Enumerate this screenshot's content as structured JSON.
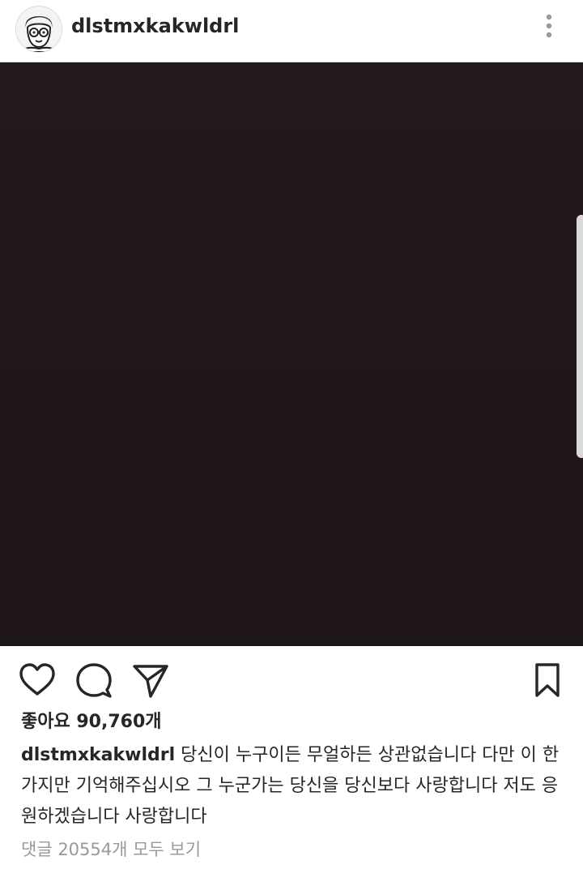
{
  "post": {
    "username": "dlstmxkakwldrl",
    "likes_text": "좋아요 90,760개",
    "caption_user": "dlstmxkakwldrl",
    "caption_text": "당신이 누구이든 무얼하든 상관없습니다 다만 이 한가지만 기억해주십시오 그 누군가는 당신을 당신보다 사랑합니다 저도 응원하겠습니다 사랑합니다",
    "comments_link": "댓글 20554개 모두 보기"
  },
  "icons": {
    "more": "more-vertical-icon",
    "like": "heart-icon",
    "comment": "comment-bubble-icon",
    "share": "paper-plane-icon",
    "save": "bookmark-icon"
  },
  "colors": {
    "text": "#262626",
    "muted": "#999999",
    "photo": "#221819",
    "divider": "#dbdbdb"
  }
}
